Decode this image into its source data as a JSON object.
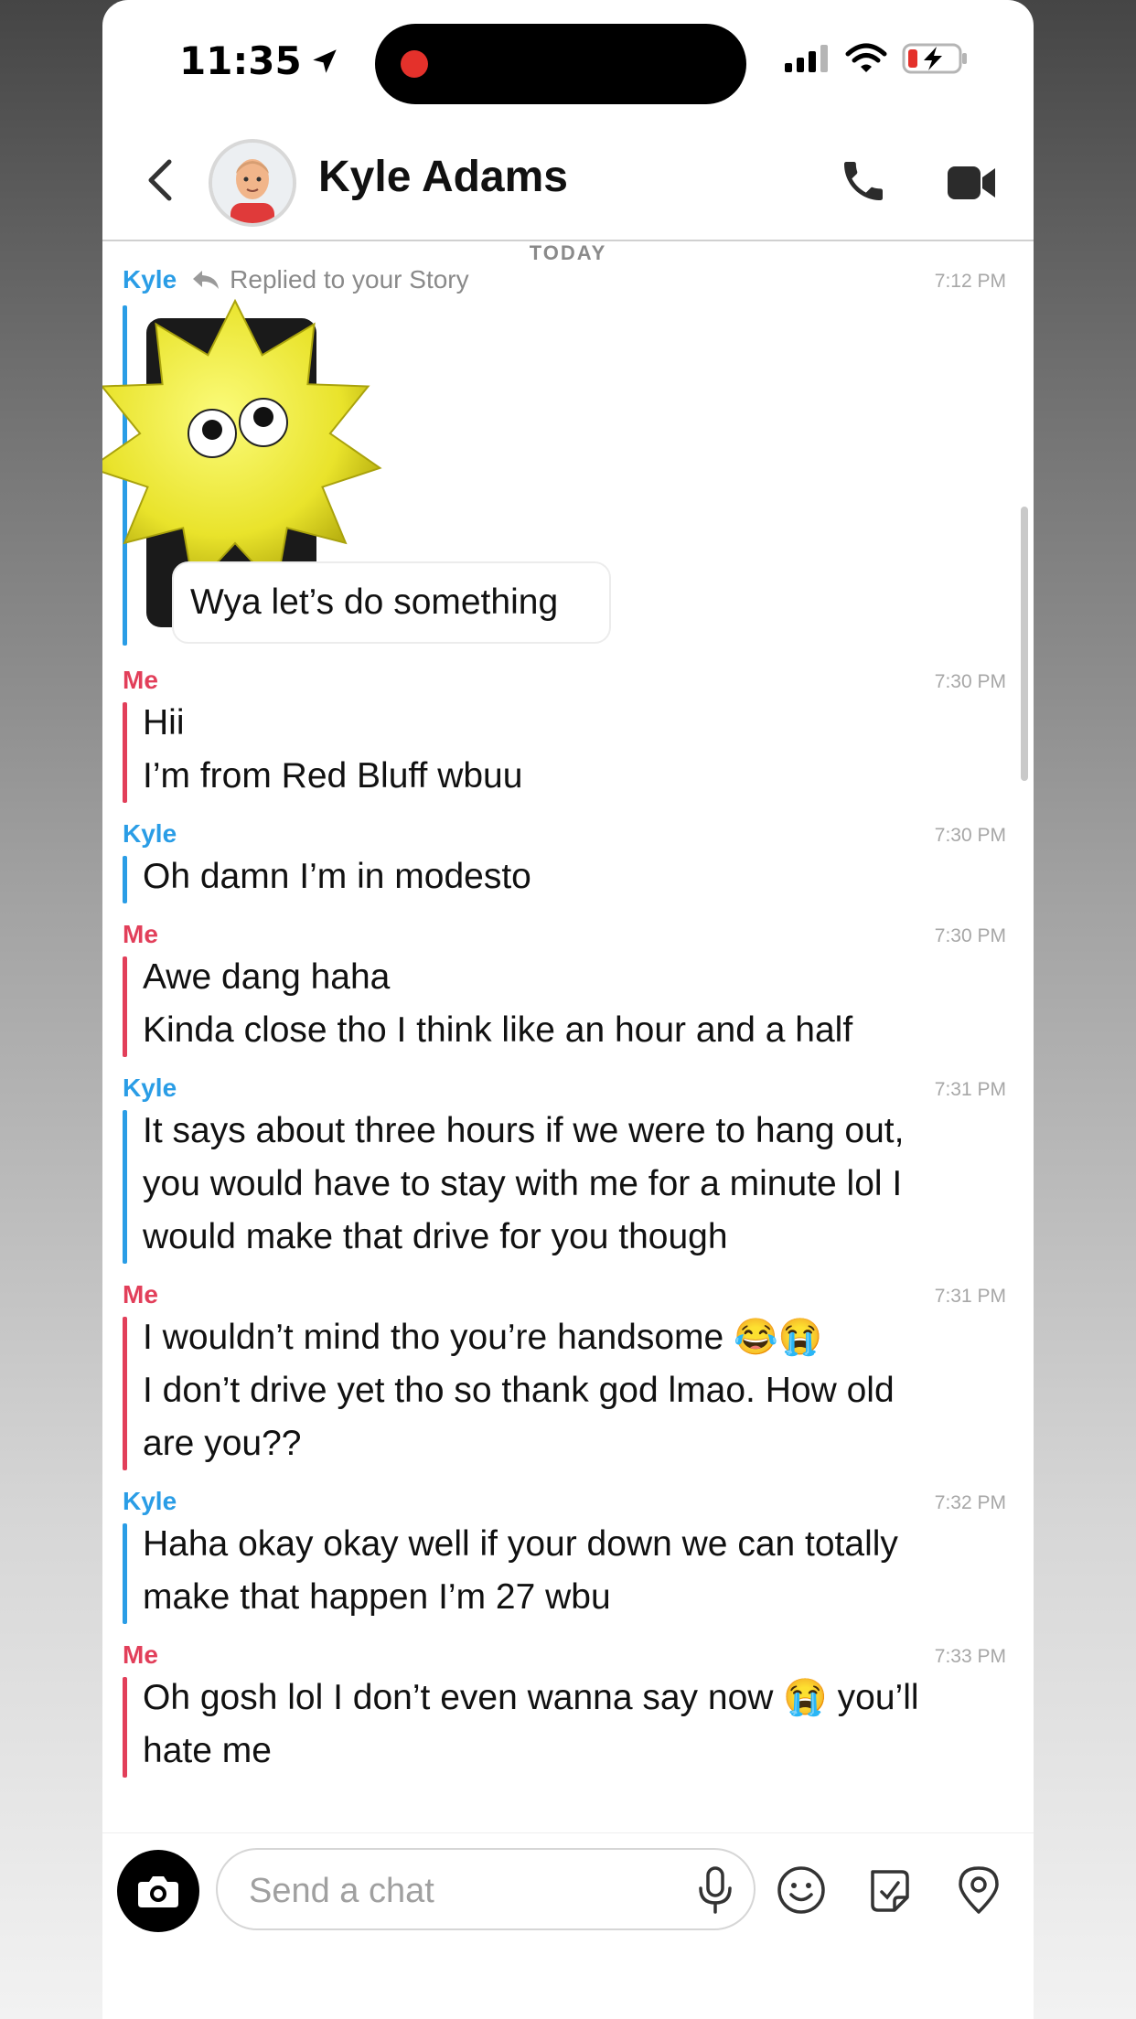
{
  "status_bar": {
    "time": "11:35",
    "location_icon": "location-arrow-icon",
    "signal_icon": "cellular-signal-icon",
    "wifi_icon": "wifi-icon",
    "battery_icon": "battery-charging-icon",
    "recording_color": "#e4312b"
  },
  "header": {
    "contact_name": "Kyle Adams",
    "back_icon": "chevron-left-icon",
    "call_icon": "phone-icon",
    "video_icon": "video-camera-icon"
  },
  "chat": {
    "date_divider": "TODAY",
    "story_reply": {
      "sender": "Kyle",
      "note": "Replied to your Story",
      "time": "7:12 PM",
      "caption": "Wya let’s do something",
      "sticker": "googly-eyed-sun-sticker"
    },
    "messages": [
      {
        "sender": "Me",
        "time": "7:30 PM",
        "lines": [
          "Hii",
          "I’m from Red Bluff wbuu"
        ]
      },
      {
        "sender": "Kyle",
        "time": "7:30 PM",
        "lines": [
          "Oh damn I’m in modesto"
        ]
      },
      {
        "sender": "Me",
        "time": "7:30 PM",
        "lines": [
          "Awe dang haha",
          "Kinda close tho I think like an hour and a half"
        ]
      },
      {
        "sender": "Kyle",
        "time": "7:31 PM",
        "lines": [
          "It says about three hours if we were to hang out,",
          "you would have to stay with me for a minute lol I",
          "would make that drive for you though"
        ]
      },
      {
        "sender": "Me",
        "time": "7:31 PM",
        "lines": [
          "I wouldn’t mind tho you’re handsome 😂😭",
          "I don’t drive yet tho so thank god lmao. How old",
          "are you??"
        ]
      },
      {
        "sender": "Kyle",
        "time": "7:32 PM",
        "lines": [
          "Haha okay okay well if your down we can totally",
          "make that happen I’m 27 wbu"
        ]
      },
      {
        "sender": "Me",
        "time": "7:33 PM",
        "lines": [
          "Oh gosh lol I don’t even wanna say now 😭 you’ll",
          "hate me"
        ]
      }
    ],
    "colors": {
      "kyle": "#2a9de6",
      "me": "#e23f5a"
    }
  },
  "input_bar": {
    "placeholder": "Send a chat",
    "camera_icon": "camera-icon",
    "mic_icon": "microphone-icon",
    "emoji_icon": "smiley-icon",
    "sticker_icon": "sticker-icon",
    "map_icon": "map-pin-icon"
  }
}
